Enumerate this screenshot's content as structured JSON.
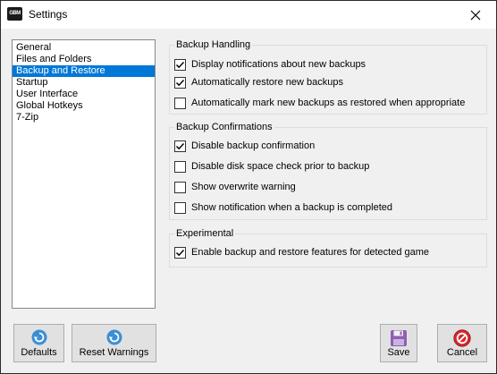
{
  "window": {
    "title": "Settings",
    "app_icon_text": "GBM"
  },
  "sidebar": {
    "items": [
      {
        "label": "General",
        "selected": false
      },
      {
        "label": "Files and Folders",
        "selected": false
      },
      {
        "label": "Backup and Restore",
        "selected": true
      },
      {
        "label": "Startup",
        "selected": false
      },
      {
        "label": "User Interface",
        "selected": false
      },
      {
        "label": "Global Hotkeys",
        "selected": false
      },
      {
        "label": "7-Zip",
        "selected": false
      }
    ]
  },
  "backup_handling": {
    "title": "Backup Handling",
    "options": [
      {
        "label": "Display notifications about new backups",
        "checked": true
      },
      {
        "label": "Automatically restore new backups",
        "checked": true
      },
      {
        "label": "Automatically mark new backups as restored when appropriate",
        "checked": false
      }
    ]
  },
  "backup_confirmations": {
    "title": "Backup Confirmations",
    "options": [
      {
        "label": "Disable backup confirmation",
        "checked": true
      },
      {
        "label": "Disable disk space check prior to backup",
        "checked": false
      },
      {
        "label": "Show overwrite warning",
        "checked": false
      },
      {
        "label": "Show notification when a backup is completed",
        "checked": false
      }
    ]
  },
  "experimental": {
    "title": "Experimental",
    "options": [
      {
        "label": "Enable backup and restore features for detected game",
        "checked": true
      }
    ]
  },
  "buttons": {
    "defaults": "Defaults",
    "reset_warnings": "Reset Warnings",
    "save": "Save",
    "cancel": "Cancel"
  },
  "icons": {
    "defaults": "refresh-icon",
    "reset_warnings": "refresh-icon",
    "save": "floppy-disk-icon",
    "cancel": "cancel-icon",
    "close": "close-icon"
  },
  "colors": {
    "selection": "#0078d7",
    "refresh_icon": "#3a8fd6",
    "save_icon": "#8e5fb2",
    "cancel_icon": "#d9262c"
  }
}
